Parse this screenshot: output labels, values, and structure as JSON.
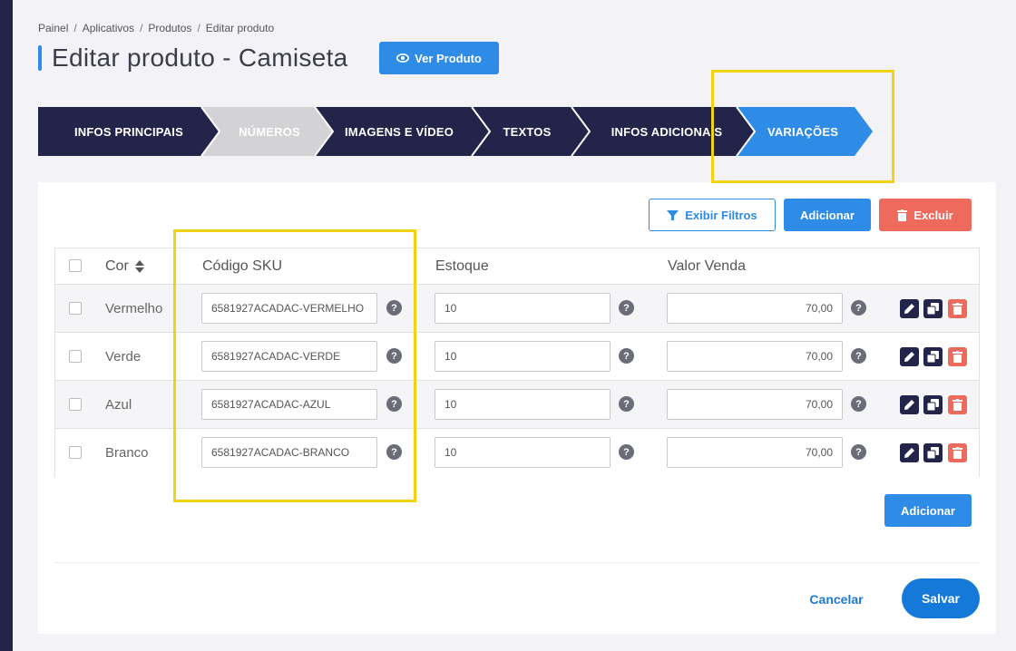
{
  "breadcrumb": {
    "items": [
      "Painel",
      "Aplicativos",
      "Produtos",
      "Editar produto"
    ],
    "separator": "/"
  },
  "page": {
    "title": "Editar produto - Camiseta",
    "view_button": "Ver Produto"
  },
  "steps": [
    {
      "label": "INFOS PRINCIPAIS",
      "state": "done",
      "color": "#23244a"
    },
    {
      "label": "NÚMEROS",
      "state": "inactive",
      "color": "#d3d3d6"
    },
    {
      "label": "IMAGENS E VÍDEO",
      "state": "done",
      "color": "#23244a"
    },
    {
      "label": "TEXTOS",
      "state": "done",
      "color": "#23244a"
    },
    {
      "label": "INFOS ADICIONAIS",
      "state": "done",
      "color": "#23244a"
    },
    {
      "label": "VARIAÇÕES",
      "state": "active",
      "color": "#2e8be6"
    }
  ],
  "toolbar": {
    "filter_label": "Exibir Filtros",
    "add_label": "Adicionar",
    "delete_label": "Excluir"
  },
  "table": {
    "headers": {
      "color": "Cor",
      "sku": "Código SKU",
      "stock": "Estoque",
      "price": "Valor Venda"
    },
    "rows": [
      {
        "color": "Vermelho",
        "sku": "6581927ACADAC-VERMELHO",
        "stock": "10",
        "price": "70,00"
      },
      {
        "color": "Verde",
        "sku": "6581927ACADAC-VERDE",
        "stock": "10",
        "price": "70,00"
      },
      {
        "color": "Azul",
        "sku": "6581927ACADAC-AZUL",
        "stock": "10",
        "price": "70,00"
      },
      {
        "color": "Branco",
        "sku": "6581927ACADAC-BRANCO",
        "stock": "10",
        "price": "70,00"
      }
    ],
    "help_glyph": "?"
  },
  "footer": {
    "add_label": "Adicionar",
    "cancel_label": "Cancelar",
    "save_label": "Salvar"
  },
  "colors": {
    "accent": "#2e8be6",
    "navy": "#23244a",
    "danger": "#ee6a5d",
    "highlight": "#f2d313"
  }
}
